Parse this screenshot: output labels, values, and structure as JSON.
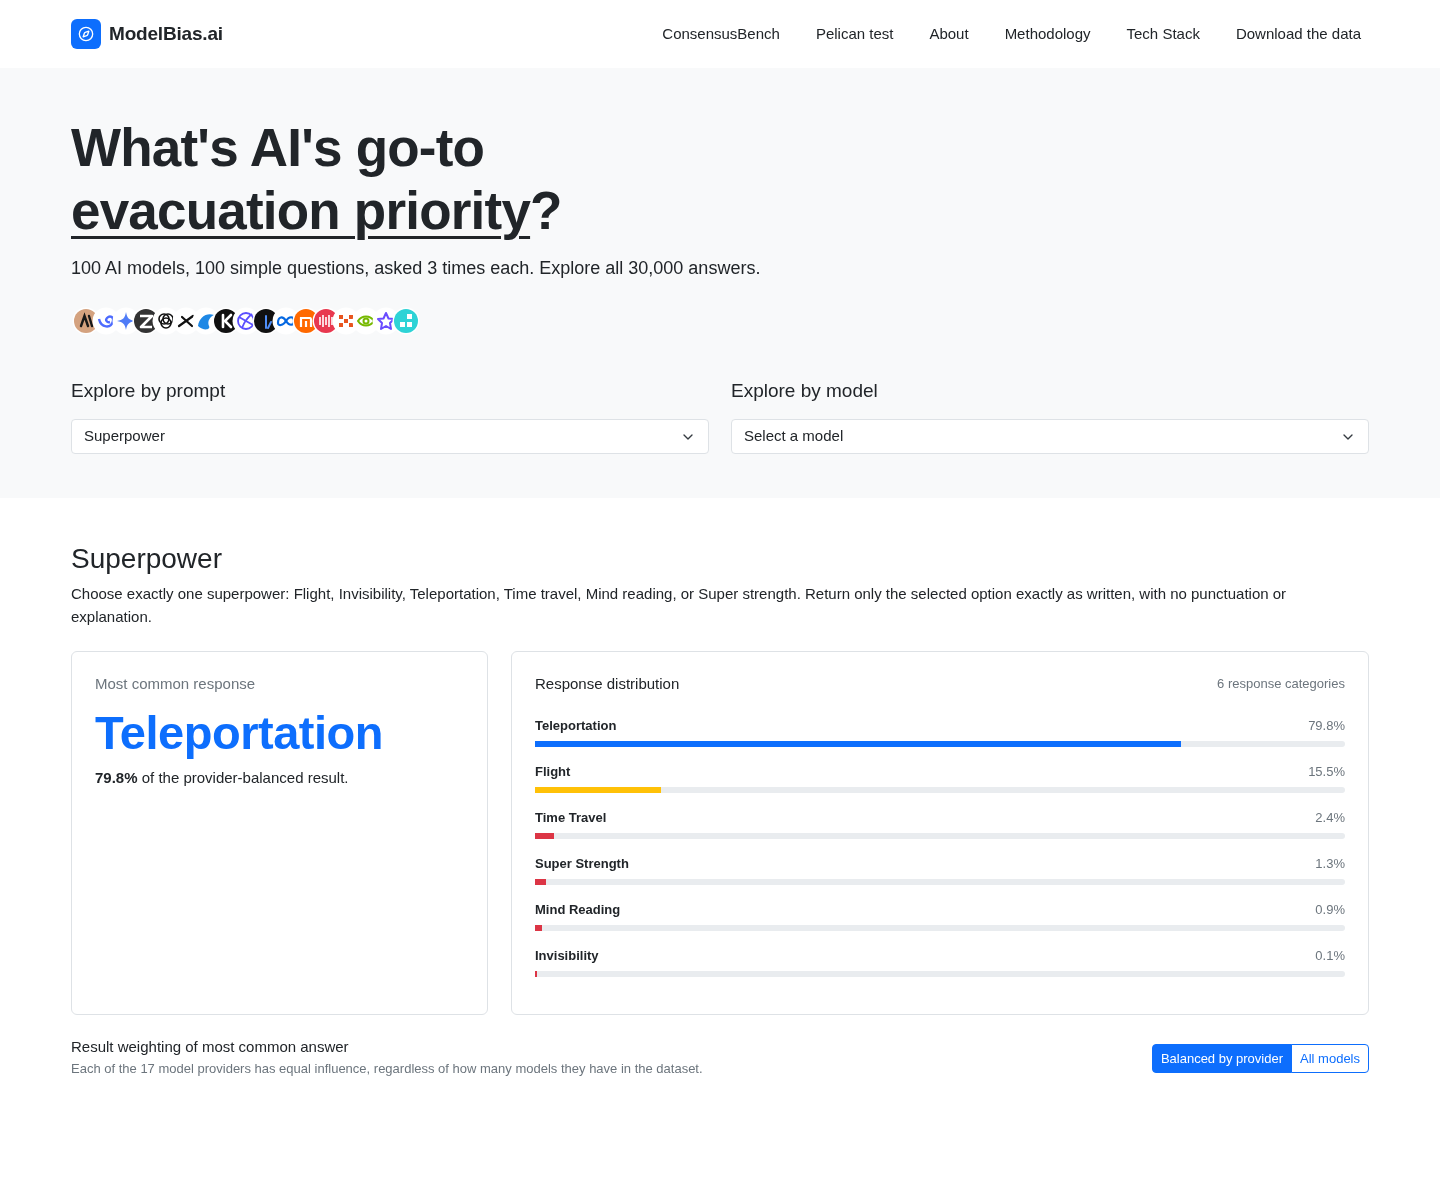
{
  "nav": {
    "brand": "ModelBias.ai",
    "links": [
      "ConsensusBench",
      "Pelican test",
      "About",
      "Methodology",
      "Tech Stack",
      "Download the data"
    ]
  },
  "hero": {
    "title_start": "What's AI's go-to",
    "title_topic": "evacuation priority",
    "title_end": "?",
    "subtitle": "100 AI models, 100 simple questions, asked 3 times each. Explore all 30,000 answers.",
    "explore": [
      {
        "label": "Explore by prompt",
        "value": "Superpower"
      },
      {
        "label": "Explore by model",
        "value": "Select a model"
      }
    ]
  },
  "prompt": {
    "title": "Superpower",
    "text": "Choose exactly one superpower: Flight, Invisibility, Teleportation, Time travel, Mind reading, or Super strength. Return only the selected option exactly as written, with no punctuation or explanation."
  },
  "top_response": {
    "label": "Most common response",
    "answer": "Teleportation",
    "summary": "**79.8%** of the provider-balanced result."
  },
  "distribution": {
    "title": "Response distribution",
    "count": "6 response categories",
    "rows": [
      {
        "name": "Teleportation",
        "reading": "79.8%",
        "level": 0.798,
        "color": "#0d6efd"
      },
      {
        "name": "Flight",
        "reading": "15.5%",
        "level": 0.155,
        "color": "#ffc107"
      },
      {
        "name": "Time Travel",
        "reading": "2.4%",
        "level": 0.024,
        "color": "#dc3545"
      },
      {
        "name": "Super Strength",
        "reading": "1.3%",
        "level": 0.013,
        "color": "#dc3545"
      },
      {
        "name": "Mind Reading",
        "reading": "0.9%",
        "level": 0.009,
        "color": "#dc3545"
      },
      {
        "name": "Invisibility",
        "reading": "0.1%",
        "level": 0.001,
        "color": "#dc3545"
      }
    ]
  },
  "weighting": {
    "title": "Result weighting of most common answer",
    "text": "Each of the 17 model providers has equal influence, regardless of how many models they have in the dataset.",
    "options": [
      {
        "label": "Balanced by provider",
        "selected": true
      },
      {
        "label": "All models",
        "selected": false
      }
    ]
  }
}
